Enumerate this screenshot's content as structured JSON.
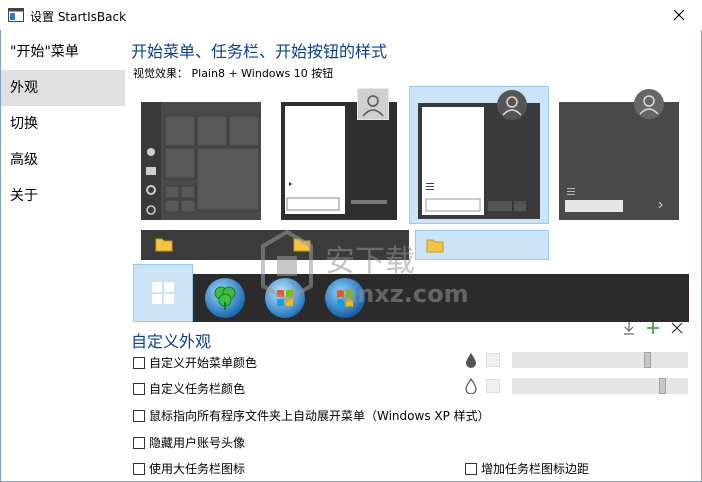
{
  "window": {
    "title": "设置 StartIsBack",
    "close_icon": "close-icon"
  },
  "sidebar": {
    "items": [
      {
        "label": "\"开始\"菜单",
        "selected": false
      },
      {
        "label": "外观",
        "selected": true
      },
      {
        "label": "切换",
        "selected": false
      },
      {
        "label": "高级",
        "selected": false
      },
      {
        "label": "关于",
        "selected": false
      }
    ]
  },
  "main": {
    "heading": "开始菜单、任务栏、开始按钮的样式",
    "visual_effect_label": "视觉效果：",
    "visual_effect_value": "Plain8 + Windows 10 按钮",
    "styles": [
      {
        "name": "windows-10-style",
        "selected": false
      },
      {
        "name": "windows-7-style",
        "selected": false
      },
      {
        "name": "plain8-style",
        "selected": true
      },
      {
        "name": "windows-8-style",
        "selected": false
      }
    ],
    "start_buttons": [
      {
        "icon": "windows-10-logo-icon",
        "selected": true
      },
      {
        "icon": "clover-orb-icon",
        "selected": false
      },
      {
        "icon": "windows-7-orb-icon",
        "selected": false
      },
      {
        "icon": "windows-xp-orb-icon",
        "selected": false
      }
    ]
  },
  "custom": {
    "heading": "自定义外观",
    "toolbar_icons": [
      "download-icon",
      "add-icon",
      "remove-icon"
    ],
    "options": [
      {
        "label": "自定义开始菜单颜色",
        "checked": false
      },
      {
        "label": "自定义任务栏颜色",
        "checked": false
      },
      {
        "label": "鼠标指向所有程序文件夹上自动展开菜单（Windows XP 样式）",
        "checked": false
      },
      {
        "label": "隐藏用户账号头像",
        "checked": false
      },
      {
        "label": "使用大任务栏图标",
        "checked": false
      },
      {
        "label": "增加任务栏图标边距",
        "checked": false
      }
    ],
    "sliders": [
      {
        "icon": "filled-drop-icon",
        "value": 0.78
      },
      {
        "icon": "outline-drop-icon",
        "value": 0.87
      }
    ]
  },
  "watermark": {
    "text": "安下载",
    "domain": "anxz.com"
  },
  "colors": {
    "accent": "#0b3f8f",
    "selection": "#cce4f7",
    "selection_border": "#99c9ef",
    "sidebar_selected": "#e0e0e0"
  }
}
